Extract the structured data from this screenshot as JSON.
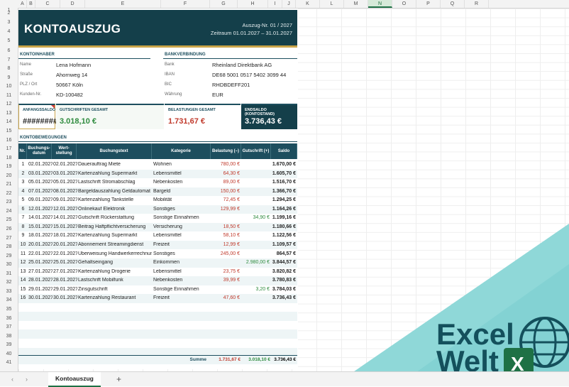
{
  "columns": [
    "A",
    "B",
    "C",
    "D",
    "E",
    "F",
    "G",
    "H",
    "I",
    "J",
    "K",
    "L",
    "M",
    "N",
    "O",
    "P",
    "Q",
    "R"
  ],
  "rows": [
    "1",
    "2",
    "3",
    "4",
    "5",
    "6",
    "7",
    "8",
    "9",
    "10",
    "11",
    "12",
    "13",
    "14",
    "15",
    "16",
    "17",
    "18",
    "19",
    "20",
    "21",
    "22",
    "23",
    "24",
    "25",
    "26",
    "27",
    "28",
    "29",
    "30",
    "31",
    "32",
    "33",
    "34",
    "35",
    "36",
    "37",
    "38",
    "39",
    "40",
    "41"
  ],
  "banner": {
    "title": "KONTOAUSZUG",
    "auszug": "Auszug-Nr.  01 / 2027",
    "zeitraum": "Zeitraum  01.01.2027 – 31.01.2027"
  },
  "kontoinhaber": {
    "head": "KONTOINHABER",
    "fields": [
      {
        "label": "Name",
        "value": "Lena Hofmann"
      },
      {
        "label": "Straße",
        "value": "Ahornweg 14"
      },
      {
        "label": "PLZ / Ort",
        "value": "50667 Köln"
      },
      {
        "label": "Kunden-Nr.",
        "value": "KD-100482"
      }
    ]
  },
  "bankverbindung": {
    "head": "BANKVERBINDUNG",
    "fields": [
      {
        "label": "Bank",
        "value": "Rheinland Direktbank AG"
      },
      {
        "label": "IBAN",
        "value": "DE68 5001 0517 5402 3099 44"
      },
      {
        "label": "BIC",
        "value": "RHDBDEFF201"
      },
      {
        "label": "Währung",
        "value": "EUR"
      }
    ]
  },
  "kpis": [
    {
      "label": "ANFANGSSALDO",
      "value": "########"
    },
    {
      "label": "GUTSCHRIFTEN GESAMT",
      "value": "3.018,10 €"
    },
    {
      "label": "BELASTUNGEN GESAMT",
      "value": "1.731,67 €"
    },
    {
      "label": "ENDSALDO (KONTOSTAND)",
      "value": "3.736,43 €"
    }
  ],
  "section_title": "KONTOBEWEGUNGEN",
  "table_headers": [
    "Nr.",
    "Buchungs-\ndatum",
    "Wert-\nstellung",
    "Buchungstext",
    "Kategorie",
    "Belastung (–)",
    "Gutschrift (+)",
    "Saldo"
  ],
  "transactions": [
    {
      "nr": "1",
      "datum": "02.01.2027",
      "wert": "02.01.2027",
      "text": "Dauerauftrag Miete",
      "kat": "Wohnen",
      "bel": "780,00 €",
      "gut": "",
      "saldo": "1.670,00 €"
    },
    {
      "nr": "2",
      "datum": "03.01.2027",
      "wert": "03.01.2027",
      "text": "Kartenzahlung Supermarkt",
      "kat": "Lebensmittel",
      "bel": "64,30 €",
      "gut": "",
      "saldo": "1.605,70 €"
    },
    {
      "nr": "3",
      "datum": "05.01.2027",
      "wert": "05.01.2027",
      "text": "Lastschrift Stromabschlag",
      "kat": "Nebenkosten",
      "bel": "89,00 €",
      "gut": "",
      "saldo": "1.516,70 €"
    },
    {
      "nr": "4",
      "datum": "07.01.2027",
      "wert": "08.01.2027",
      "text": "Bargeldauszahlung Geldautomat",
      "kat": "Bargeld",
      "bel": "150,00 €",
      "gut": "",
      "saldo": "1.366,70 €"
    },
    {
      "nr": "5",
      "datum": "09.01.2027",
      "wert": "09.01.2027",
      "text": "Kartenzahlung Tankstelle",
      "kat": "Mobilität",
      "bel": "72,45 €",
      "gut": "",
      "saldo": "1.294,25 €"
    },
    {
      "nr": "6",
      "datum": "12.01.2027",
      "wert": "12.01.2027",
      "text": "Onlinekauf Elektronik",
      "kat": "Sonstiges",
      "bel": "129,99 €",
      "gut": "",
      "saldo": "1.164,26 €"
    },
    {
      "nr": "7",
      "datum": "14.01.2027",
      "wert": "14.01.2027",
      "text": "Gutschrift Rückerstattung",
      "kat": "Sonstige Einnahmen",
      "bel": "",
      "gut": "34,90 €",
      "saldo": "1.199,16 €"
    },
    {
      "nr": "8",
      "datum": "15.01.2027",
      "wert": "15.01.2027",
      "text": "Beitrag Haftpflichtversicherung",
      "kat": "Versicherung",
      "bel": "18,50 €",
      "gut": "",
      "saldo": "1.180,66 €"
    },
    {
      "nr": "9",
      "datum": "18.01.2027",
      "wert": "18.01.2027",
      "text": "Kartenzahlung Supermarkt",
      "kat": "Lebensmittel",
      "bel": "58,10 €",
      "gut": "",
      "saldo": "1.122,56 €"
    },
    {
      "nr": "10",
      "datum": "20.01.2027",
      "wert": "20.01.2027",
      "text": "Abonnement Streamingdienst",
      "kat": "Freizeit",
      "bel": "12,99 €",
      "gut": "",
      "saldo": "1.109,57 €"
    },
    {
      "nr": "11",
      "datum": "22.01.2027",
      "wert": "22.01.2027",
      "text": "Überweisung Handwerkerrechnung",
      "kat": "Sonstiges",
      "bel": "245,00 €",
      "gut": "",
      "saldo": "864,57 €"
    },
    {
      "nr": "12",
      "datum": "25.01.2027",
      "wert": "25.01.2027",
      "text": "Gehaltseingang",
      "kat": "Einkommen",
      "bel": "",
      "gut": "2.980,00 €",
      "saldo": "3.844,57 €"
    },
    {
      "nr": "13",
      "datum": "27.01.2027",
      "wert": "27.01.2027",
      "text": "Kartenzahlung Drogerie",
      "kat": "Lebensmittel",
      "bel": "23,75 €",
      "gut": "",
      "saldo": "3.820,82 €"
    },
    {
      "nr": "14",
      "datum": "28.01.2027",
      "wert": "28.01.2027",
      "text": "Lastschrift Mobilfunk",
      "kat": "Nebenkosten",
      "bel": "39,99 €",
      "gut": "",
      "saldo": "3.780,83 €"
    },
    {
      "nr": "15",
      "datum": "29.01.2027",
      "wert": "29.01.2027",
      "text": "Zinsgutschrift",
      "kat": "Sonstige Einnahmen",
      "bel": "",
      "gut": "3,20 €",
      "saldo": "3.784,03 €"
    },
    {
      "nr": "16",
      "datum": "30.01.2027",
      "wert": "30.01.2027",
      "text": "Kartenzahlung Restaurant",
      "kat": "Freizeit",
      "bel": "47,60 €",
      "gut": "",
      "saldo": "3.736,43 €"
    }
  ],
  "summe": {
    "label": "Summe",
    "bel": "1.731,67 €",
    "gut": "3.018,10 €",
    "saldo": "3.736,43 €"
  },
  "tabbar": {
    "sheet": "Kontoauszug",
    "prev": "‹",
    "next": "›",
    "add": "+"
  },
  "logo": {
    "line1": "Excel",
    "line2": "Welt"
  },
  "colors": {
    "banner": "#143f4a",
    "accent": "#1d4e5e",
    "gold": "#c9a449",
    "negative": "#c0392b",
    "positive": "#2e8b3e",
    "logo_bg": "#8fd8d8"
  }
}
